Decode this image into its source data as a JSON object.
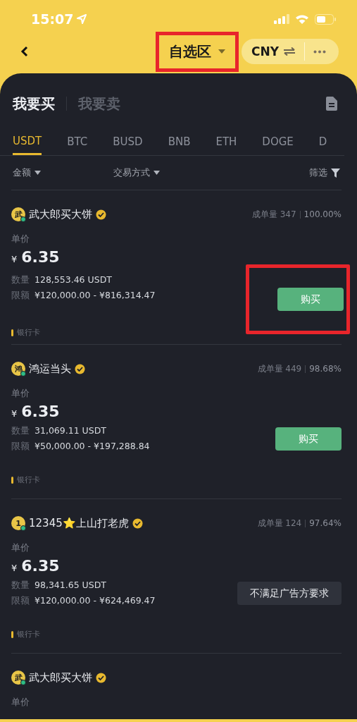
{
  "status_bar": {
    "time": "15:07"
  },
  "header": {
    "title": "自选区",
    "title_highlighted": true,
    "currency": "CNY"
  },
  "side_tabs": [
    {
      "label": "我要买",
      "selected": true
    },
    {
      "label": "我要卖",
      "selected": false
    }
  ],
  "coin_tabs": [
    {
      "label": "USDT",
      "selected": true
    },
    {
      "label": "BTC",
      "selected": false
    },
    {
      "label": "BUSD",
      "selected": false
    },
    {
      "label": "BNB",
      "selected": false
    },
    {
      "label": "ETH",
      "selected": false
    },
    {
      "label": "DOGE",
      "selected": false
    },
    {
      "label": "D",
      "selected": false
    }
  ],
  "filters": {
    "amount": "金额",
    "payment": "交易方式",
    "filter": "筛选"
  },
  "ads": [
    {
      "avatar": "武",
      "online": true,
      "name": "武大郎买大饼",
      "orders_label": "成单量",
      "orders": "347",
      "rate": "100.00%",
      "price_label": "单价",
      "currency_sign": "¥",
      "price": "6.35",
      "qty_label": "数量",
      "qty": "128,553.46 USDT",
      "limit_label": "限额",
      "limit": "¥120,000.00 - ¥816,314.47",
      "kind": "buy",
      "action": "购买",
      "action_highlighted": true,
      "payment": "银行卡"
    },
    {
      "avatar": "鸿",
      "online": true,
      "name": "鸿运当头",
      "orders_label": "成单量",
      "orders": "449",
      "rate": "98.68%",
      "price_label": "单价",
      "currency_sign": "¥",
      "price": "6.35",
      "qty_label": "数量",
      "qty": "31,069.11 USDT",
      "limit_label": "限额",
      "limit": "¥50,000.00 - ¥197,288.84",
      "kind": "buy",
      "action": "购买",
      "action_highlighted": false,
      "payment": "银行卡"
    },
    {
      "avatar": "1",
      "online": true,
      "name": "12345⭐上山打老虎",
      "orders_label": "成单量",
      "orders": "124",
      "rate": "97.64%",
      "price_label": "单价",
      "currency_sign": "¥",
      "price": "6.35",
      "qty_label": "数量",
      "qty": "98,341.65 USDT",
      "limit_label": "限额",
      "limit": "¥120,000.00 - ¥624,469.47",
      "kind": "unavailable",
      "action": "不满足广告方要求",
      "action_highlighted": false,
      "payment": "银行卡"
    },
    {
      "avatar": "武",
      "online": true,
      "name": "武大郎买大饼",
      "price_label": "单价"
    }
  ]
}
